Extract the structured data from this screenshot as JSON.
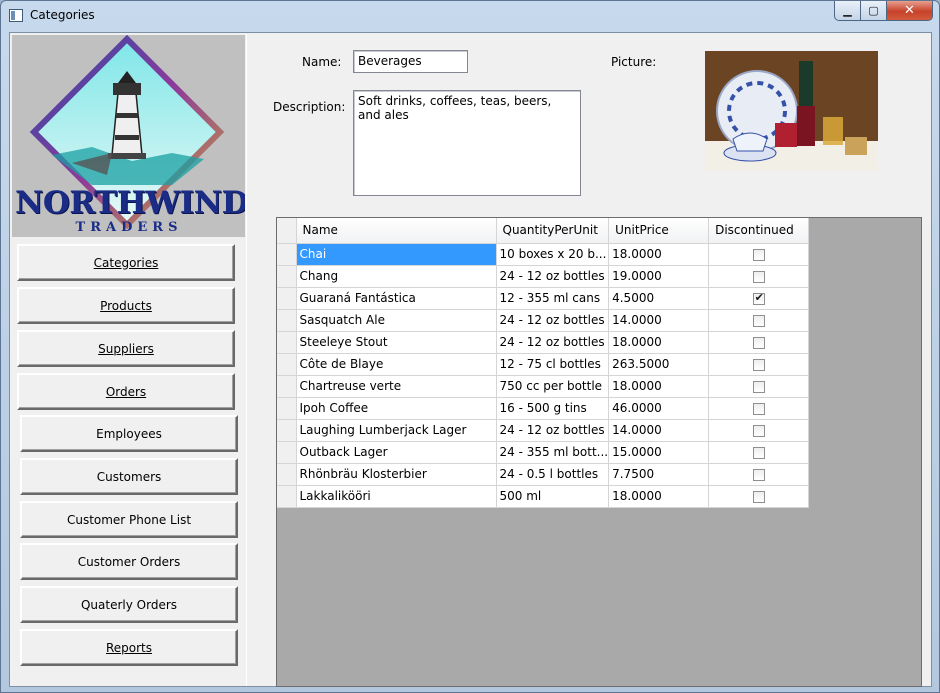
{
  "window": {
    "title": "Categories",
    "min_icon": "minimize-icon",
    "max_icon": "maximize-icon",
    "close_icon": "close-icon"
  },
  "logo": {
    "line1": "NORTHWIND",
    "line2": "TRADERS"
  },
  "nav": [
    {
      "label": "Categories",
      "underline": true
    },
    {
      "label": "Products",
      "underline": true
    },
    {
      "label": "Suppliers",
      "underline": true
    },
    {
      "label": "Orders",
      "underline": true
    },
    {
      "label": "Employees",
      "underline": false
    },
    {
      "label": "Customers",
      "underline": false
    },
    {
      "label": "Customer Phone List",
      "underline": false
    },
    {
      "label": "Customer Orders",
      "underline": false
    },
    {
      "label": "Quaterly Orders",
      "underline": false
    },
    {
      "label": "Reports",
      "underline": true
    }
  ],
  "form": {
    "name_label": "Name:",
    "name_value": "Beverages",
    "description_label": "Description:",
    "description_value": "Soft drinks, coffees, teas, beers, and ales",
    "picture_label": "Picture:"
  },
  "grid": {
    "columns": [
      "Name",
      "QuantityPerUnit",
      "UnitPrice",
      "Discontinued"
    ],
    "rows": [
      {
        "name": "Chai",
        "qty": "10 boxes x 20 b...",
        "price": "18.0000",
        "discontinued": false
      },
      {
        "name": "Chang",
        "qty": "24 - 12 oz bottles",
        "price": "19.0000",
        "discontinued": false
      },
      {
        "name": "Guaraná Fantástica",
        "qty": "12 - 355 ml cans",
        "price": "4.5000",
        "discontinued": true
      },
      {
        "name": "Sasquatch Ale",
        "qty": "24 - 12 oz bottles",
        "price": "14.0000",
        "discontinued": false
      },
      {
        "name": "Steeleye Stout",
        "qty": "24 - 12 oz bottles",
        "price": "18.0000",
        "discontinued": false
      },
      {
        "name": "Côte de Blaye",
        "qty": "12 - 75 cl bottles",
        "price": "263.5000",
        "discontinued": false
      },
      {
        "name": "Chartreuse verte",
        "qty": "750 cc per bottle",
        "price": "18.0000",
        "discontinued": false
      },
      {
        "name": "Ipoh Coffee",
        "qty": "16 - 500 g tins",
        "price": "46.0000",
        "discontinued": false
      },
      {
        "name": "Laughing Lumberjack Lager",
        "qty": "24 - 12 oz bottles",
        "price": "14.0000",
        "discontinued": false
      },
      {
        "name": "Outback Lager",
        "qty": "24 - 355 ml bott...",
        "price": "15.0000",
        "discontinued": false
      },
      {
        "name": "Rhönbräu Klosterbier",
        "qty": "24 - 0.5 l bottles",
        "price": "7.7500",
        "discontinued": false
      },
      {
        "name": "Lakkalikööri",
        "qty": "500 ml",
        "price": "18.0000",
        "discontinued": false
      }
    ]
  }
}
